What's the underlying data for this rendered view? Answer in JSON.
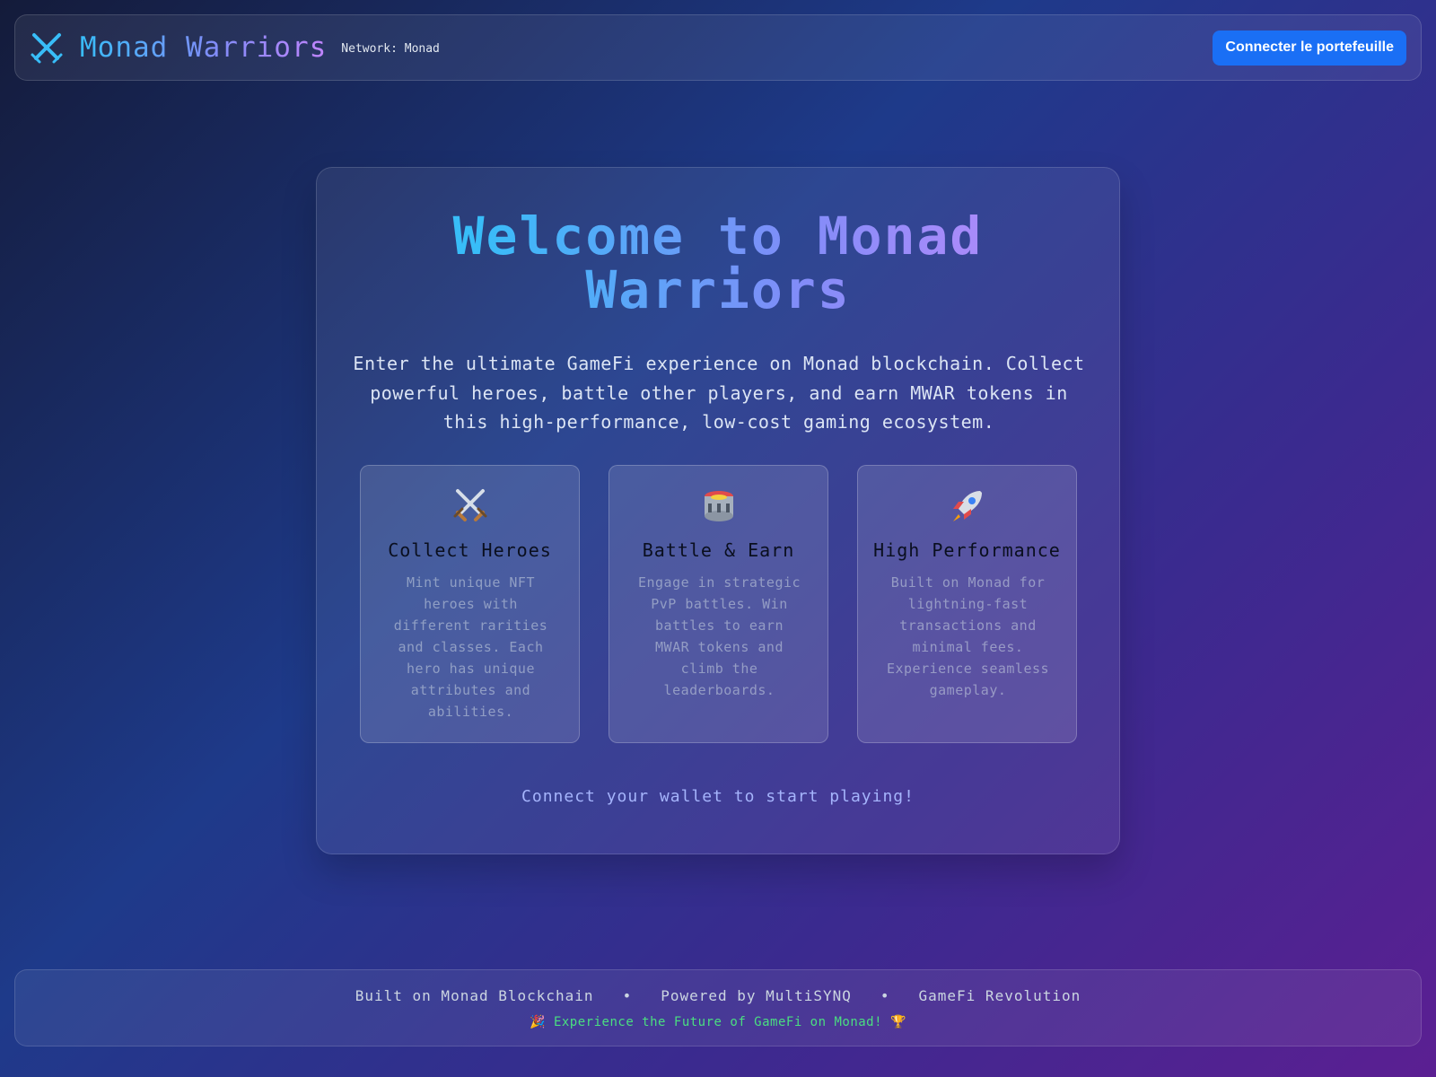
{
  "header": {
    "title": "Monad Warriors",
    "network": "Network: Monad",
    "connect_label": "Connecter le portefeuille",
    "logo_icon": "crossed-swords-icon"
  },
  "main": {
    "welcome": "Welcome to Monad Warriors",
    "intro": "Enter the ultimate GameFi experience on Monad blockchain. Collect powerful heroes, battle other players, and earn MWAR tokens in this high-performance, low-cost gaming ecosystem.",
    "features": [
      {
        "icon": "⚔️",
        "icon_name": "crossed-swords-icon",
        "title": "Collect Heroes",
        "desc": "Mint unique NFT heroes with different rarities and classes. Each hero has unique attributes and abilities."
      },
      {
        "icon": "🏟️",
        "icon_name": "stadium-icon",
        "title": "Battle & Earn",
        "desc": "Engage in strategic PvP battles. Win battles to earn MWAR tokens and climb the leaderboards."
      },
      {
        "icon": "🚀",
        "icon_name": "rocket-icon",
        "title": "High Performance",
        "desc": "Built on Monad for lightning-fast transactions and minimal fees. Experience seamless gameplay."
      }
    ],
    "cta": "Connect your wallet to start playing!"
  },
  "footer": {
    "links": [
      "Built on Monad Blockchain",
      "Powered by MultiSYNQ",
      "GameFi Revolution"
    ],
    "separator": "•",
    "tagline": "🎉 Experience the Future of GameFi on Monad! 🏆"
  },
  "colors": {
    "accent_button": "#1a6ff5",
    "title_gradient_start": "#38bdf8",
    "title_gradient_end": "#c084fc",
    "tagline": "#4ade80"
  }
}
